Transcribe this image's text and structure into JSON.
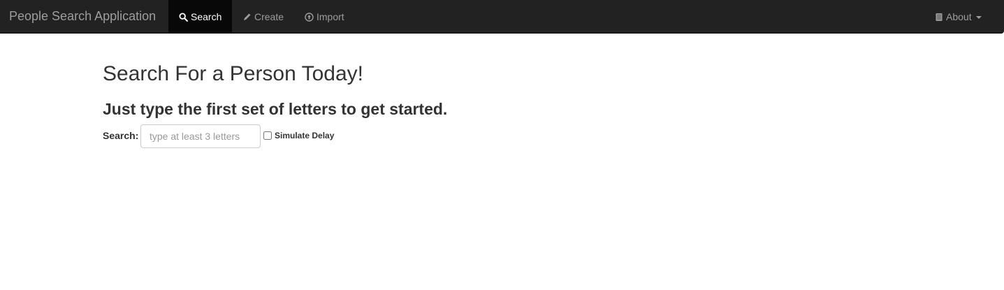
{
  "navbar": {
    "brand": "People Search Application",
    "items": [
      {
        "label": "Search",
        "icon": "search-icon",
        "active": true
      },
      {
        "label": "Create",
        "icon": "pencil-icon",
        "active": false
      },
      {
        "label": "Import",
        "icon": "upload-circle-icon",
        "active": false
      }
    ],
    "about": {
      "label": "About",
      "icon": "book-icon"
    }
  },
  "main": {
    "title": "Search For a Person Today!",
    "subtitle": "Just type the first set of letters to get started.",
    "search_label": "Search:",
    "search_placeholder": "type at least 3 letters",
    "search_value": "",
    "delay_label": "Simulate Delay",
    "delay_checked": false
  },
  "colors": {
    "navbar_bg": "#222222",
    "navbar_active_bg": "#080808",
    "navbar_text": "#9d9d9d",
    "text": "#333333"
  }
}
